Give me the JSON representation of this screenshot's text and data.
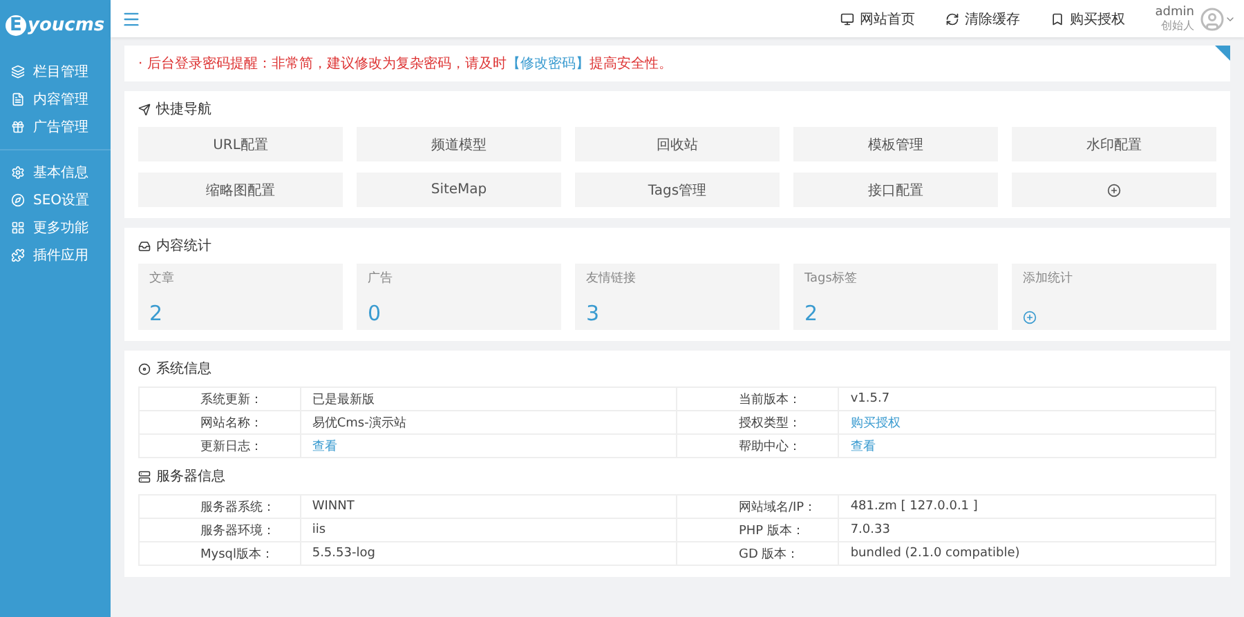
{
  "brand": {
    "mark": "E",
    "name": "youcms"
  },
  "sidebar": {
    "sections": [
      {
        "items": [
          {
            "label": "栏目管理",
            "kind": "layers"
          },
          {
            "label": "内容管理",
            "kind": "file"
          },
          {
            "label": "广告管理",
            "kind": "gift"
          }
        ]
      },
      {
        "items": [
          {
            "label": "基本信息",
            "kind": "gear"
          },
          {
            "label": "SEO设置",
            "kind": "compass"
          },
          {
            "label": "更多功能",
            "kind": "grid"
          },
          {
            "label": "插件应用",
            "kind": "plug"
          }
        ]
      }
    ]
  },
  "topbar": {
    "links": [
      {
        "label": "网站首页",
        "kind": "monitor"
      },
      {
        "label": "清除缓存",
        "kind": "refresh"
      },
      {
        "label": "购买授权",
        "kind": "bookmark"
      }
    ],
    "user": {
      "name": "admin",
      "role": "创始人"
    }
  },
  "notice": {
    "before": "· 后台登录密码提醒：非常简，建议修改为复杂密码，请及时",
    "link": "【修改密码】",
    "after": "提高安全性。"
  },
  "quick_nav": {
    "title": "快捷导航",
    "items": [
      {
        "label": "URL配置",
        "kind": "text"
      },
      {
        "label": "频道模型",
        "kind": "text"
      },
      {
        "label": "回收站",
        "kind": "text"
      },
      {
        "label": "模板管理",
        "kind": "text"
      },
      {
        "label": "水印配置",
        "kind": "text"
      },
      {
        "label": "缩略图配置",
        "kind": "text"
      },
      {
        "label": "SiteMap",
        "kind": "text"
      },
      {
        "label": "Tags管理",
        "kind": "text"
      },
      {
        "label": "接口配置",
        "kind": "text"
      },
      {
        "kind": "add"
      }
    ]
  },
  "stats": {
    "title": "内容统计",
    "items": [
      {
        "label": "文章",
        "value": "2",
        "kind": "count"
      },
      {
        "label": "广告",
        "value": "0",
        "kind": "count"
      },
      {
        "label": "友情链接",
        "value": "3",
        "kind": "count"
      },
      {
        "label": "Tags标签",
        "value": "2",
        "kind": "count"
      },
      {
        "label": "添加统计",
        "kind": "add"
      }
    ]
  },
  "system_info": {
    "title": "系统信息",
    "rows": [
      [
        {
          "text": "系统更新：",
          "kind": "label"
        },
        {
          "text": "已是最新版",
          "kind": "value"
        },
        {
          "text": "当前版本：",
          "kind": "label"
        },
        {
          "text": "v1.5.7",
          "kind": "value"
        }
      ],
      [
        {
          "text": "网站名称：",
          "kind": "label"
        },
        {
          "text": "易优Cms-演示站",
          "kind": "value"
        },
        {
          "text": "授权类型：",
          "kind": "label"
        },
        {
          "text": "购买授权",
          "kind": "link"
        }
      ],
      [
        {
          "text": "更新日志：",
          "kind": "label"
        },
        {
          "text": "查看",
          "kind": "link"
        },
        {
          "text": "帮助中心：",
          "kind": "label"
        },
        {
          "text": "查看",
          "kind": "link"
        }
      ]
    ]
  },
  "server_info": {
    "title": "服务器信息",
    "rows": [
      [
        {
          "text": "服务器系统：",
          "kind": "label"
        },
        {
          "text": "WINNT",
          "kind": "value"
        },
        {
          "text": "网站域名/IP：",
          "kind": "label"
        },
        {
          "text": "481.zm [ 127.0.0.1 ]",
          "kind": "value"
        }
      ],
      [
        {
          "text": "服务器环境：",
          "kind": "label"
        },
        {
          "text": "iis",
          "kind": "value"
        },
        {
          "text": "PHP 版本：",
          "kind": "label"
        },
        {
          "text": "7.0.33",
          "kind": "value"
        }
      ],
      [
        {
          "text": "Mysql版本：",
          "kind": "label"
        },
        {
          "text": "5.5.53-log",
          "kind": "value"
        },
        {
          "text": "GD 版本：",
          "kind": "label"
        },
        {
          "text": "bundled (2.1.0 compatible)",
          "kind": "value"
        }
      ]
    ]
  }
}
